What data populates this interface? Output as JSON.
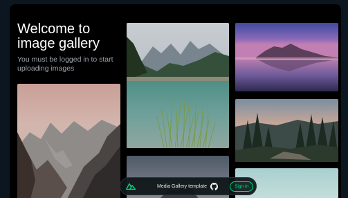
{
  "page": {
    "title": "Welcome to image gallery",
    "subtitle": "You must be logged in to start uploading images"
  },
  "gallery": {
    "images": [
      {
        "name": "mountain-lake",
        "alt": "Alpine lake with reeds"
      },
      {
        "name": "sunset-reflection",
        "alt": "Mountain reflected at dusk"
      },
      {
        "name": "pine-forest",
        "alt": "Pine forest at sunset"
      },
      {
        "name": "rocky-peaks",
        "alt": "Rocky mountain peaks"
      },
      {
        "name": "dusk-mountain",
        "alt": "Mountain at dusk"
      },
      {
        "name": "teal-sky",
        "alt": "Pale teal sky"
      }
    ]
  },
  "toolbar": {
    "label": "Media Gallery template",
    "signin_label": "Sign in",
    "logo_icon": "nuxt-logo-icon",
    "github_icon": "github-icon"
  },
  "colors": {
    "accent": "#00dc82",
    "background": "#000000",
    "outer_background": "#0c1621"
  }
}
